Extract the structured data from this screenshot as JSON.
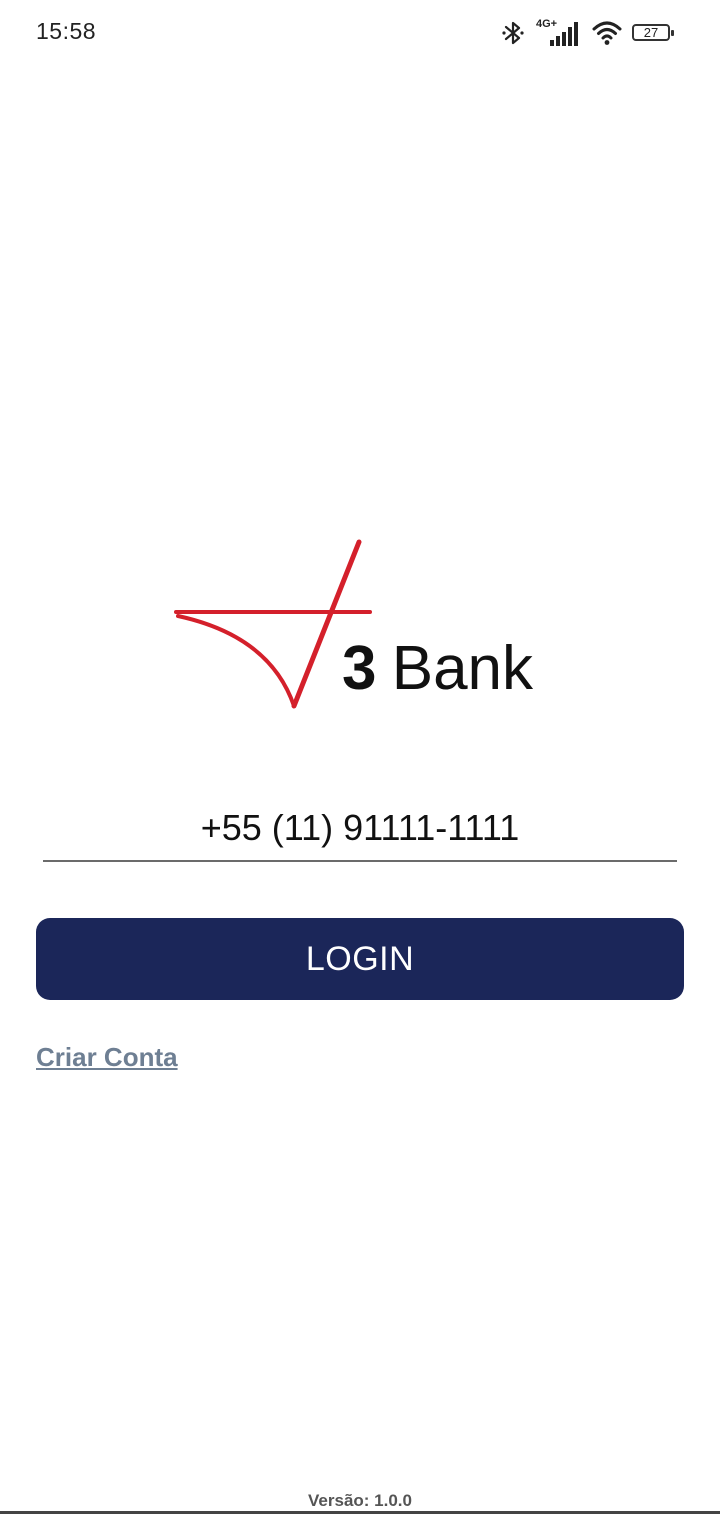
{
  "status_bar": {
    "time": "15:58",
    "network_label": "4G+",
    "battery_level": "27",
    "icons": [
      "bluetooth-icon",
      "cellular-signal-icon",
      "wifi-icon",
      "battery-icon"
    ]
  },
  "logo": {
    "number": "3",
    "name": "Bank",
    "accent_color": "#d4202b"
  },
  "login_form": {
    "phone_value": "+55 (11) 91111-1111",
    "login_label": "LOGIN",
    "create_account_label": "Criar Conta"
  },
  "footer": {
    "version": "Versão: 1.0.0"
  },
  "colors": {
    "button_bg": "#1b2659",
    "link": "#6e7f93"
  }
}
